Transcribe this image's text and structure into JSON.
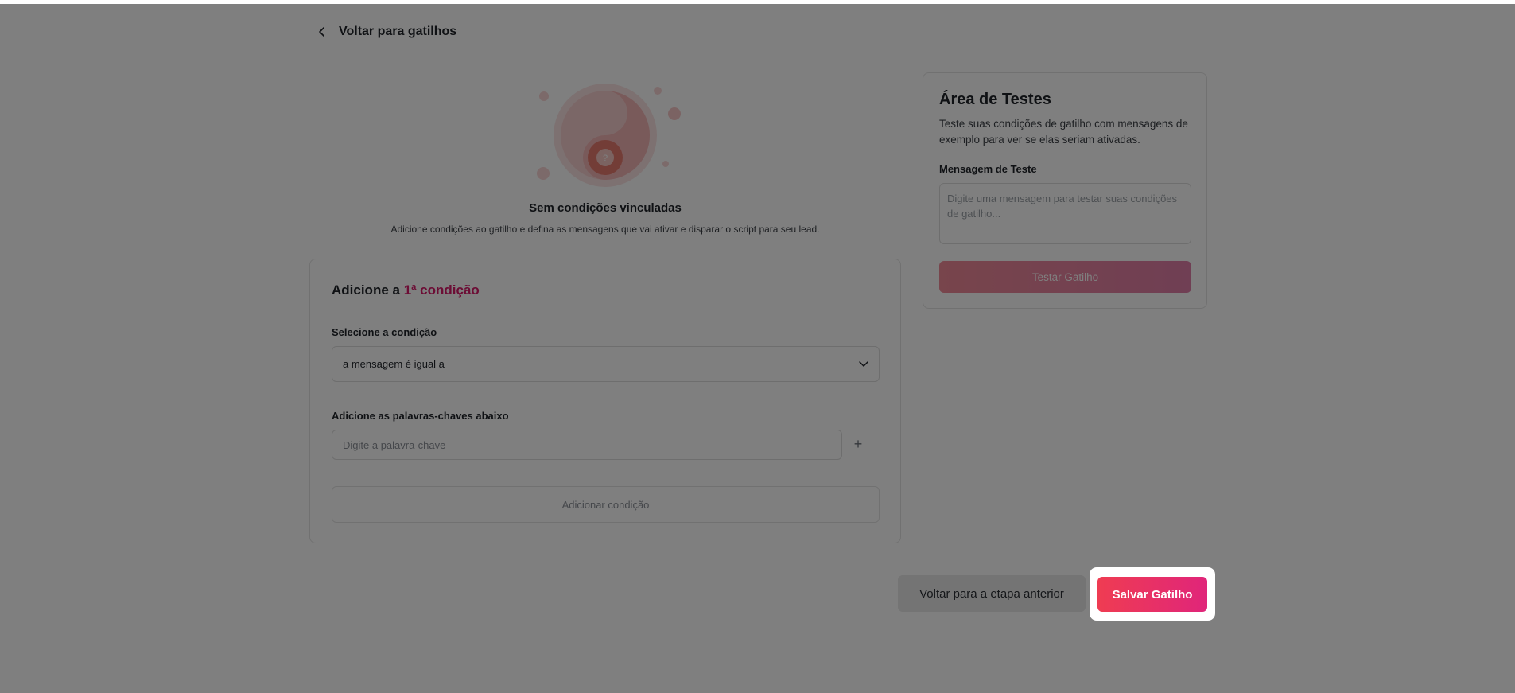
{
  "header": {
    "back_label": "Voltar para gatilhos"
  },
  "empty_state": {
    "title": "Sem condições vinculadas",
    "description": "Adicione condições ao gatilho e defina as mensagens que vai ativar e disparar o script para seu lead.",
    "icon_glyph": "?"
  },
  "condition_card": {
    "heading_prefix": "Adicione a ",
    "heading_accent": "1ª condição",
    "select_label": "Selecione a condição",
    "select_value": "a mensagem é igual a",
    "keywords_label": "Adicione as palavras-chaves abaixo",
    "keyword_placeholder": "Digite a palavra-chave",
    "plus_label": "+",
    "add_condition_label": "Adicionar condição"
  },
  "test_area": {
    "title": "Área de Testes",
    "description": "Teste suas condições de gatilho com mensagens de exemplo para ver se elas seriam ativadas.",
    "message_label": "Mensagem de Teste",
    "message_placeholder": "Digite uma mensagem para testar suas condições de gatilho...",
    "test_button_label": "Testar Gatilho"
  },
  "footer": {
    "previous_label": "Voltar para a etapa anterior",
    "save_label": "Salvar Gatilho"
  },
  "colors": {
    "accent": "#d81b6a",
    "primary_gradient_start": "#ef3c52",
    "primary_gradient_end": "#e0257a",
    "overlay": "rgba(0,0,0,0.5)"
  },
  "icons": {
    "back": "chevron-left-icon",
    "select": "chevron-down-icon",
    "add": "plus-icon",
    "illustration": "yin-yang-question-illustration"
  }
}
